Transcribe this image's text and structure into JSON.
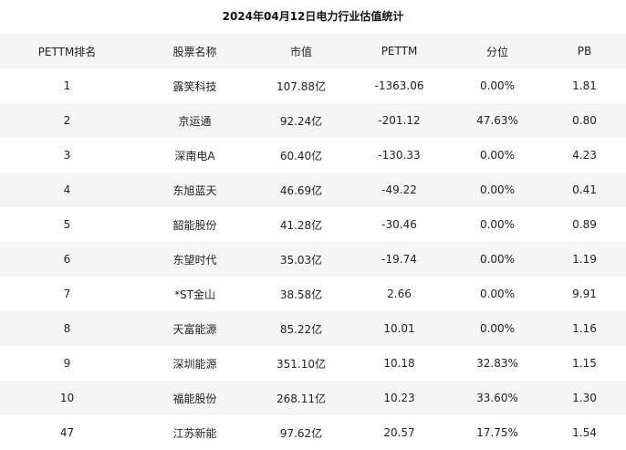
{
  "title": "2024年04月12日电力行业估值统计",
  "columns": [
    "PETTM排名",
    "股票名称",
    "市值",
    "PETTM",
    "分位",
    "PB"
  ],
  "rows": [
    [
      "1",
      "露笑科技",
      "107.88亿",
      "-1363.06",
      "0.00%",
      "1.81"
    ],
    [
      "2",
      "京运通",
      "92.24亿",
      "-201.12",
      "47.63%",
      "0.80"
    ],
    [
      "3",
      "深南电A",
      "60.40亿",
      "-130.33",
      "0.00%",
      "4.23"
    ],
    [
      "4",
      "东旭蓝天",
      "46.69亿",
      "-49.22",
      "0.00%",
      "0.41"
    ],
    [
      "5",
      "韶能股份",
      "41.28亿",
      "-30.46",
      "0.00%",
      "0.89"
    ],
    [
      "6",
      "东望时代",
      "35.03亿",
      "-19.74",
      "0.00%",
      "1.19"
    ],
    [
      "7",
      "*ST金山",
      "38.58亿",
      "2.66",
      "0.00%",
      "9.91"
    ],
    [
      "8",
      "天富能源",
      "85.22亿",
      "10.01",
      "0.00%",
      "1.16"
    ],
    [
      "9",
      "深圳能源",
      "351.10亿",
      "10.18",
      "32.83%",
      "1.15"
    ],
    [
      "10",
      "福能股份",
      "268.11亿",
      "10.23",
      "33.60%",
      "1.30"
    ],
    [
      "47",
      "江苏新能",
      "97.62亿",
      "20.57",
      "17.75%",
      "1.54"
    ]
  ]
}
